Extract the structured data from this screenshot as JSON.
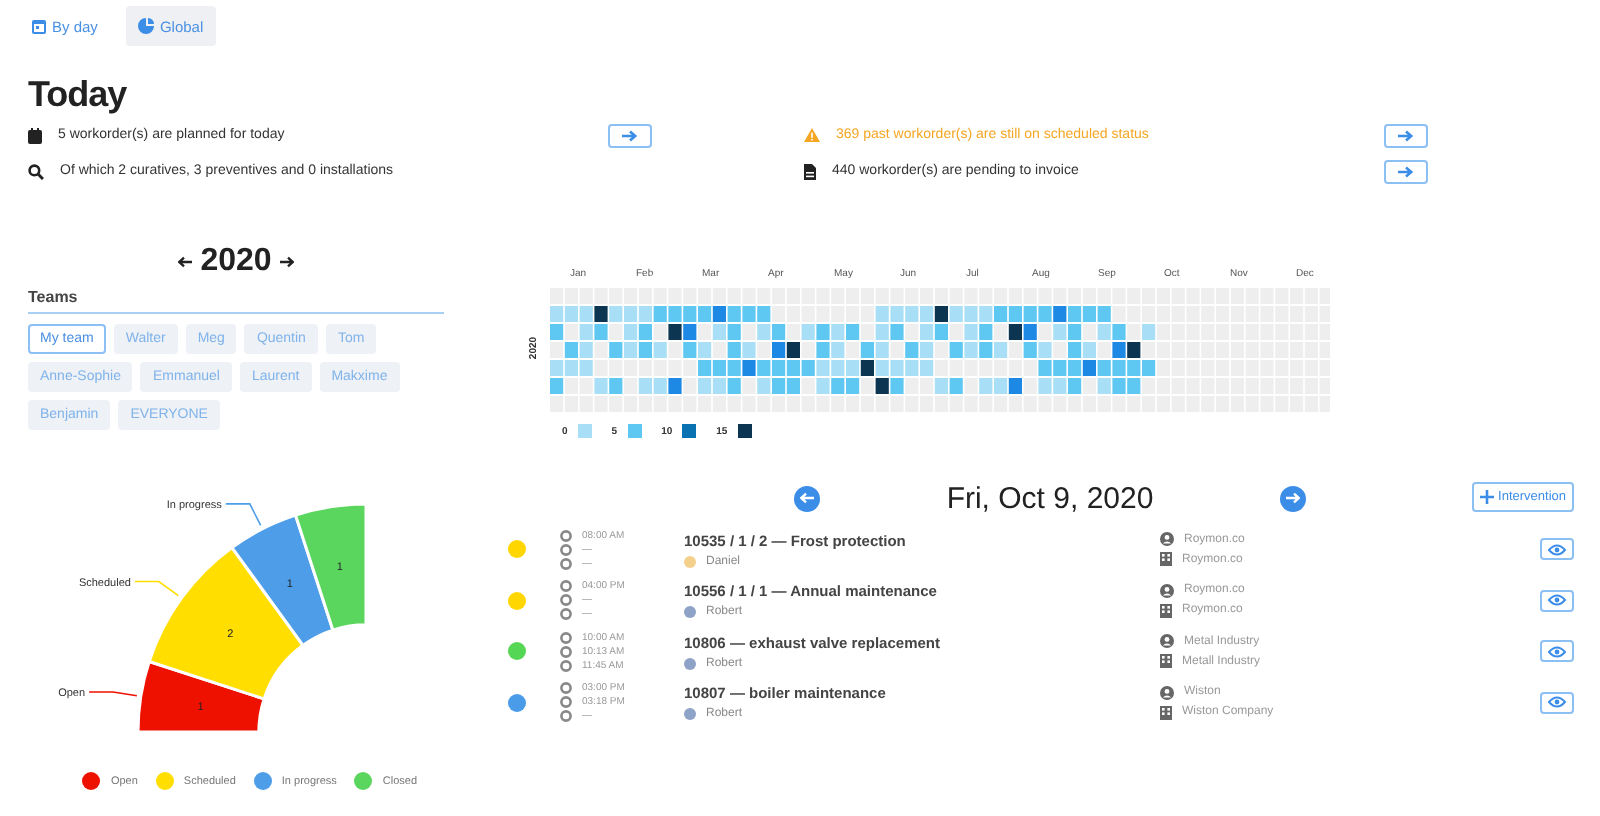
{
  "view_tabs": [
    {
      "label": "By day",
      "kind": "calendar",
      "selected": false
    },
    {
      "label": "Global",
      "kind": "pie",
      "selected": true
    }
  ],
  "today": {
    "title": "Today",
    "left": [
      {
        "kind": "calendar",
        "text": "5 workorder(s) are planned for today",
        "action": true
      },
      {
        "kind": "search",
        "text": "Of which 2 curatives, 3 preventives and 0 installations",
        "action": false
      }
    ],
    "right": [
      {
        "kind": "warning",
        "text": "369 past workorder(s) are still on scheduled status",
        "action": true
      },
      {
        "kind": "invoice",
        "text": "440 workorder(s) are pending to invoice",
        "action": true
      }
    ]
  },
  "year_nav": {
    "year": "2020"
  },
  "teams": {
    "title": "Teams",
    "chips": [
      {
        "label": "My team",
        "selected": true
      },
      {
        "label": "Walter",
        "selected": false
      },
      {
        "label": "Meg",
        "selected": false
      },
      {
        "label": "Quentin",
        "selected": false
      },
      {
        "label": "Tom",
        "selected": false
      },
      {
        "label": "Anne-Sophie",
        "selected": false
      },
      {
        "label": "Emmanuel",
        "selected": false
      },
      {
        "label": "Laurent",
        "selected": false
      },
      {
        "label": "Makxime",
        "selected": false
      },
      {
        "label": "Benjamin",
        "selected": false
      },
      {
        "label": "EVERYONE",
        "selected": false
      }
    ]
  },
  "heatmap": {
    "year_label": "2020",
    "months": [
      "Jan",
      "Feb",
      "Mar",
      "Apr",
      "May",
      "Jun",
      "Jul",
      "Aug",
      "Sep",
      "Oct",
      "Nov",
      "Dec"
    ],
    "legend": [
      {
        "label": "0",
        "color": "#a9dff6"
      },
      {
        "label": "5",
        "color": "#5fc8f2"
      },
      {
        "label": "10",
        "color": "#0a72b0"
      },
      {
        "label": "15",
        "color": "#0b3550"
      }
    ]
  },
  "status_chart": {
    "slice_labels": [
      "Open",
      "Scheduled",
      "In progress"
    ],
    "chart_data": {
      "type": "donut",
      "categories": [
        "Open",
        "Scheduled",
        "In progress",
        "Closed"
      ],
      "values": [
        1,
        2,
        1,
        1
      ],
      "data_labels": true
    },
    "legend": [
      {
        "color": "#ee1100"
      },
      {
        "color": "#ffde00"
      },
      {
        "color": "#4d9de8"
      },
      {
        "color": "#5ad65e"
      }
    ]
  },
  "day": {
    "date": "Fri, Oct 9, 2020",
    "add_button": "Intervention",
    "events": [
      {
        "color": "#ffd600",
        "times": [
          "08:00 AM",
          "—",
          "—"
        ],
        "title": "10535 / 1 / 2 — Frost protection",
        "person": {
          "name": "Daniel",
          "color": "#f3d08c"
        },
        "client": "Roymon.co",
        "company": "Roymon.co"
      },
      {
        "color": "#ffd600",
        "times": [
          "04:00 PM",
          "—",
          "—"
        ],
        "title": "10556 / 1 / 1 — Annual maintenance",
        "person": {
          "name": "Robert",
          "color": "#8fa3c9"
        },
        "client": "Roymon.co",
        "company": "Roymon.co"
      },
      {
        "color": "#55d655",
        "times": [
          "10:00 AM",
          "10:13 AM",
          "11:45 AM"
        ],
        "title": "10806 — exhaust valve replacement",
        "person": {
          "name": "Robert",
          "color": "#8fa3c9"
        },
        "client": "Metal Industry",
        "company": "Metall Industry"
      },
      {
        "color": "#4a9be8",
        "times": [
          "03:00 PM",
          "03:18 PM",
          "—"
        ],
        "title": "10807 — boiler maintenance",
        "person": {
          "name": "Robert",
          "color": "#8fa3c9"
        },
        "client": "Wiston",
        "company": "Wiston Company"
      }
    ]
  }
}
